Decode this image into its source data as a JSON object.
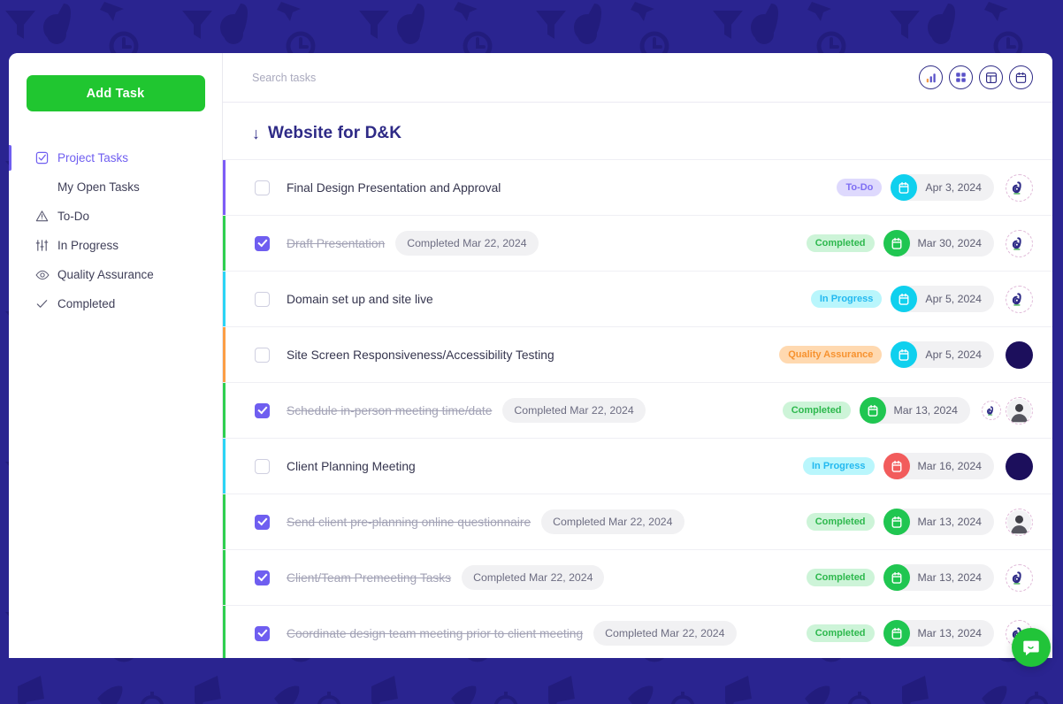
{
  "theme": {
    "bg_dark": "#2a2490",
    "accent_purple": "#6f5ef0",
    "green": "#20c630",
    "cyan": "#0fd0ee",
    "orange": "#f9a34a",
    "red": "#f25c5c",
    "title_blue": "#2e2a86"
  },
  "sidebar": {
    "add_task_label": "Add Task",
    "items": [
      {
        "label": "Project Tasks",
        "icon": "checked-square-icon",
        "active": true,
        "sub": false
      },
      {
        "label": "My Open Tasks",
        "icon": "",
        "active": false,
        "sub": true
      },
      {
        "label": "To-Do",
        "icon": "warning-triangle-icon",
        "active": false,
        "sub": false
      },
      {
        "label": "In Progress",
        "icon": "sliders-icon",
        "active": false,
        "sub": false
      },
      {
        "label": "Quality Assurance",
        "icon": "eye-icon",
        "active": false,
        "sub": false
      },
      {
        "label": "Completed",
        "icon": "check-icon",
        "active": false,
        "sub": false
      }
    ]
  },
  "topbar": {
    "search_placeholder": "Search tasks",
    "search_value": "",
    "view_toggles": [
      {
        "name": "chart-view-icon"
      },
      {
        "name": "grid-view-icon"
      },
      {
        "name": "board-view-icon"
      },
      {
        "name": "calendar-view-icon"
      }
    ]
  },
  "group": {
    "arrow": "↓",
    "title": "Website for D&K"
  },
  "tasks": [
    {
      "name": "Final Design Presentation and Approval",
      "checked": false,
      "completed_chip": "",
      "status": "To-Do",
      "status_bg": "#ded9fd",
      "status_fg": "#7e6ef3",
      "date": "Apr 3, 2024",
      "date_icon_bg": "#0fd0ee",
      "edge_color": "#7d5cf6",
      "avatars": [
        "logo"
      ]
    },
    {
      "name": "Draft Presentation",
      "checked": true,
      "completed_chip": "Completed Mar 22, 2024",
      "status": "Completed",
      "status_bg": "#cdf4d8",
      "status_fg": "#2db84d",
      "date": "Mar 30, 2024",
      "date_icon_bg": "#20c651",
      "edge_color": "#2ecf4f",
      "avatars": [
        "logo"
      ]
    },
    {
      "name": "Domain set up and site live",
      "checked": false,
      "completed_chip": "",
      "status": "In Progress",
      "status_bg": "#b9f6fc",
      "status_fg": "#23b9f0",
      "date": "Apr 5, 2024",
      "date_icon_bg": "#0fd0ee",
      "edge_color": "#2bd4f5",
      "avatars": [
        "logo"
      ]
    },
    {
      "name": "Site Screen Responsiveness/Accessibility Testing",
      "checked": false,
      "completed_chip": "",
      "status": "Quality Assurance",
      "status_bg": "#ffd9b0",
      "status_fg": "#f7922f",
      "date": "Apr 5, 2024",
      "date_icon_bg": "#0fd0ee",
      "edge_color": "#fb9e45",
      "avatars": [
        "solid"
      ]
    },
    {
      "name": "Schedule in-person meeting time/date",
      "checked": true,
      "completed_chip": "Completed Mar 22, 2024",
      "status": "Completed",
      "status_bg": "#cdf4d8",
      "status_fg": "#2db84d",
      "date": "Mar 13, 2024",
      "date_icon_bg": "#20c651",
      "edge_color": "#2ecf4f",
      "avatars": [
        "logo-small",
        "person"
      ]
    },
    {
      "name": "Client Planning Meeting",
      "checked": false,
      "completed_chip": "",
      "status": "In Progress",
      "status_bg": "#b9f6fc",
      "status_fg": "#23b9f0",
      "date": "Mar 16, 2024",
      "date_icon_bg": "#f25c5c",
      "edge_color": "#2bd4f5",
      "avatars": [
        "solid"
      ]
    },
    {
      "name": "Send client pre-planning online questionnaire",
      "checked": true,
      "completed_chip": "Completed Mar 22, 2024",
      "status": "Completed",
      "status_bg": "#cdf4d8",
      "status_fg": "#2db84d",
      "date": "Mar 13, 2024",
      "date_icon_bg": "#20c651",
      "edge_color": "#2ecf4f",
      "avatars": [
        "person"
      ]
    },
    {
      "name": "Client/Team Premeeting Tasks",
      "checked": true,
      "completed_chip": "Completed Mar 22, 2024",
      "status": "Completed",
      "status_bg": "#cdf4d8",
      "status_fg": "#2db84d",
      "date": "Mar 13, 2024",
      "date_icon_bg": "#20c651",
      "edge_color": "#2ecf4f",
      "avatars": [
        "logo"
      ]
    },
    {
      "name": "Coordinate design team meeting prior to client meeting",
      "checked": true,
      "completed_chip": "Completed Mar 22, 2024",
      "status": "Completed",
      "status_bg": "#cdf4d8",
      "status_fg": "#2db84d",
      "date": "Mar 13, 2024",
      "date_icon_bg": "#20c651",
      "edge_color": "#2ecf4f",
      "avatars": [
        "logo"
      ]
    }
  ],
  "chat_widget": {
    "icon": "chat-bubble-icon"
  }
}
